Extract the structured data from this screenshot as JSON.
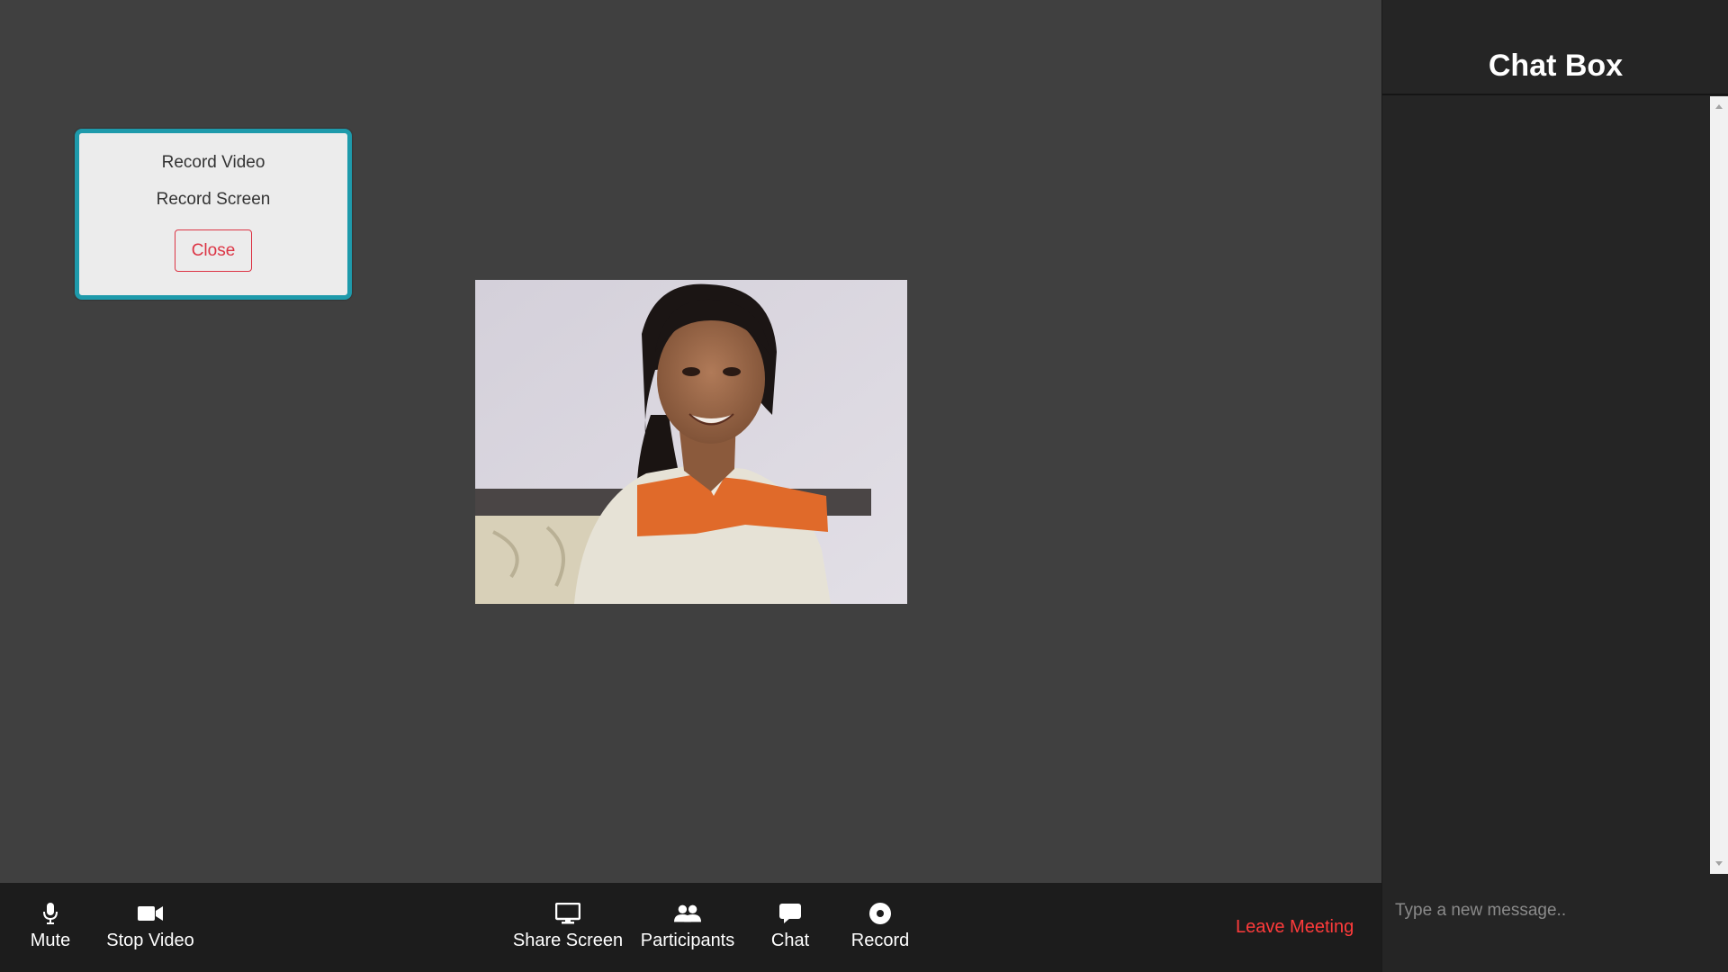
{
  "record_menu": {
    "record_video_label": "Record Video",
    "record_screen_label": "Record Screen",
    "close_label": "Close",
    "border_color": "#1e9aab",
    "close_color": "#dc3545"
  },
  "video": {
    "participant_icon": "participant-video-feed"
  },
  "toolbar": {
    "mute_label": "Mute",
    "stop_video_label": "Stop Video",
    "share_screen_label": "Share Screen",
    "participants_label": "Participants",
    "chat_label": "Chat",
    "record_label": "Record",
    "leave_label": "Leave Meeting",
    "leave_color": "#ff3b3b",
    "icons": [
      "microphone-icon",
      "video-camera-icon",
      "monitor-icon",
      "users-icon",
      "chat-bubble-icon",
      "record-icon"
    ]
  },
  "chat": {
    "title": "Chat Box",
    "input_placeholder": "Type a new message..",
    "input_value": ""
  },
  "colors": {
    "stage_bg": "#404040",
    "toolbar_bg": "#1c1c1c",
    "chat_bg": "#252525"
  }
}
